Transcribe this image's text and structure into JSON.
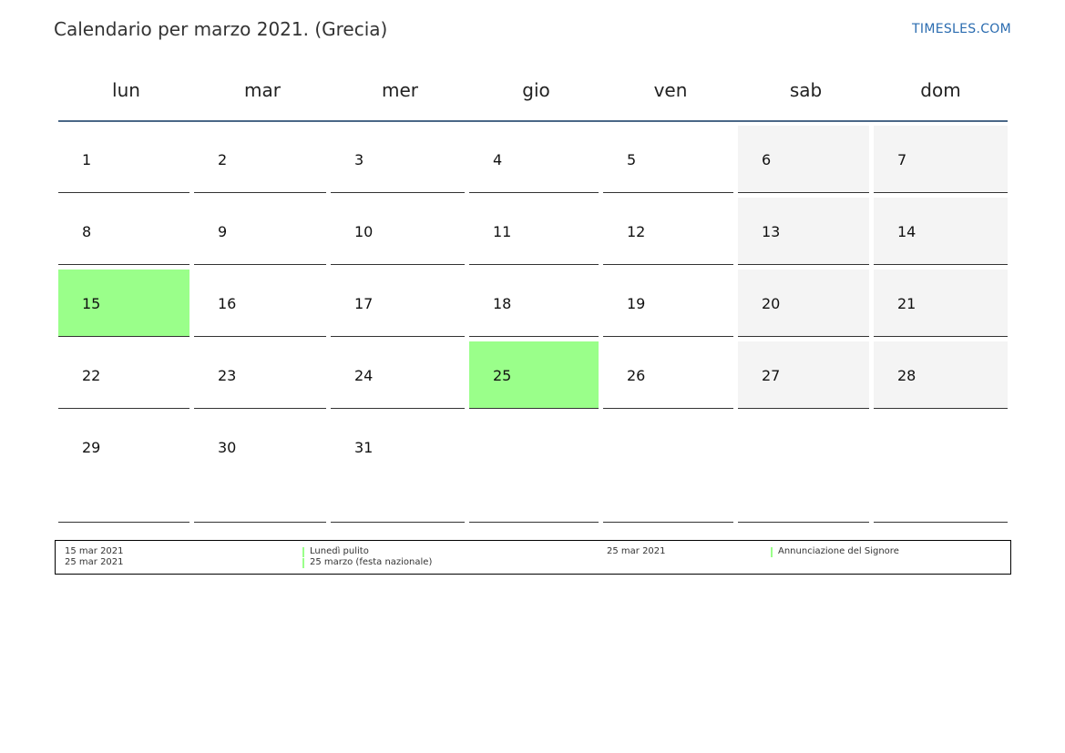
{
  "title": "Calendario per marzo 2021. (Grecia)",
  "site": "TIMESLES.COM",
  "colors": {
    "holiday": "#9aff8a",
    "weekend": "#f4f4f4",
    "header_rule": "#4a6787",
    "link": "#2b6cb0"
  },
  "weekdays": [
    "lun",
    "mar",
    "mer",
    "gio",
    "ven",
    "sab",
    "dom"
  ],
  "weeks": [
    [
      {
        "day": "1",
        "type": "normal"
      },
      {
        "day": "2",
        "type": "normal"
      },
      {
        "day": "3",
        "type": "normal"
      },
      {
        "day": "4",
        "type": "normal"
      },
      {
        "day": "5",
        "type": "normal"
      },
      {
        "day": "6",
        "type": "weekend"
      },
      {
        "day": "7",
        "type": "weekend"
      }
    ],
    [
      {
        "day": "8",
        "type": "normal"
      },
      {
        "day": "9",
        "type": "normal"
      },
      {
        "day": "10",
        "type": "normal"
      },
      {
        "day": "11",
        "type": "normal"
      },
      {
        "day": "12",
        "type": "normal"
      },
      {
        "day": "13",
        "type": "weekend"
      },
      {
        "day": "14",
        "type": "weekend"
      }
    ],
    [
      {
        "day": "15",
        "type": "holiday"
      },
      {
        "day": "16",
        "type": "normal"
      },
      {
        "day": "17",
        "type": "normal"
      },
      {
        "day": "18",
        "type": "normal"
      },
      {
        "day": "19",
        "type": "normal"
      },
      {
        "day": "20",
        "type": "weekend"
      },
      {
        "day": "21",
        "type": "weekend"
      }
    ],
    [
      {
        "day": "22",
        "type": "normal"
      },
      {
        "day": "23",
        "type": "normal"
      },
      {
        "day": "24",
        "type": "normal"
      },
      {
        "day": "25",
        "type": "holiday"
      },
      {
        "day": "26",
        "type": "normal"
      },
      {
        "day": "27",
        "type": "weekend"
      },
      {
        "day": "28",
        "type": "weekend"
      }
    ],
    [
      {
        "day": "29",
        "type": "normal"
      },
      {
        "day": "30",
        "type": "normal"
      },
      {
        "day": "31",
        "type": "normal"
      },
      {
        "day": "",
        "type": "empty"
      },
      {
        "day": "",
        "type": "empty"
      },
      {
        "day": "",
        "type": "empty"
      },
      {
        "day": "",
        "type": "empty"
      }
    ]
  ],
  "legend": [
    {
      "date": "15 mar 2021",
      "name": "Lunedì pulito"
    },
    {
      "date": "25 mar 2021",
      "name": "25 marzo (festa nazionale)"
    },
    {
      "date": "25 mar 2021",
      "name": "Annunciazione del Signore"
    }
  ]
}
